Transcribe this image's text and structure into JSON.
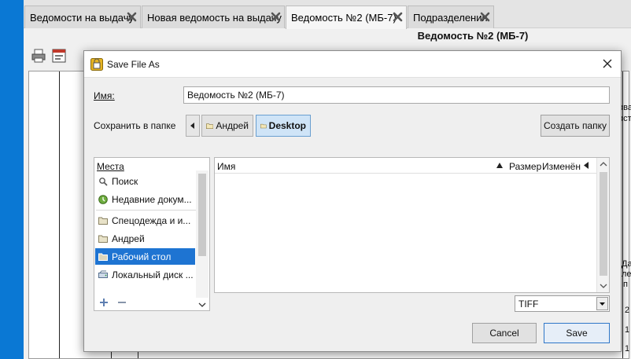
{
  "tabs": [
    {
      "label": "Ведомости на выдачу"
    },
    {
      "label": "Новая ведомость на выдачу"
    },
    {
      "label": "Ведомость №2 (МБ-7)"
    },
    {
      "label": "Подразделения"
    }
  ],
  "document": {
    "title": "Ведомость №2 (МБ-7)"
  },
  "background_fragments": [
    "ова",
    "ост",
    "Да",
    "ле",
    "п",
    "2",
    "1",
    "1"
  ],
  "dialog": {
    "title": "Save File As",
    "name_label": "Имя:",
    "name_value": "Ведомость №2 (МБ-7)",
    "folder_label": "Сохранить в папке",
    "breadcrumbs": [
      "Андрей",
      "Desktop"
    ],
    "create_folder_label": "Создать папку",
    "places_header": "Места",
    "places": [
      {
        "label": "Поиск",
        "icon": "search-icon"
      },
      {
        "label": "Недавние докум...",
        "icon": "recent-icon"
      },
      {
        "label": "Спецодежда и и...",
        "icon": "folder-icon"
      },
      {
        "label": "Андрей",
        "icon": "folder-icon"
      },
      {
        "label": "Рабочий стол",
        "icon": "folder-icon",
        "selected": true
      },
      {
        "label": "Локальный диск ...",
        "icon": "drive-icon"
      }
    ],
    "columns": {
      "name": "Имя",
      "size": "Размер",
      "modified": "Изменён"
    },
    "file_type": "TIFF",
    "cancel_label": "Cancel",
    "save_label": "Save"
  },
  "colors": {
    "desktop": "#0a78d4",
    "selection": "#1e74d2",
    "crumb_active": "#cfe4f7"
  }
}
